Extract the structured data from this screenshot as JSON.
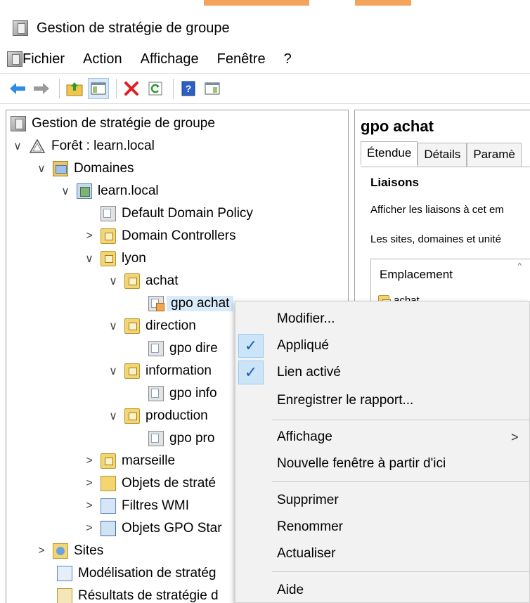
{
  "window": {
    "title": "Gestion de stratégie de groupe"
  },
  "menu": [
    "Fichier",
    "Action",
    "Affichage",
    "Fenêtre",
    "?"
  ],
  "toolbar": [
    "back-arrow-icon",
    "forward-arrow-icon",
    "up-folder-icon",
    "console-tree-icon",
    "delete-icon",
    "refresh-icon",
    "help-icon",
    "properties-icon"
  ],
  "tree": {
    "root": "Gestion de stratégie de groupe",
    "forest": "Forêt : learn.local",
    "domains": "Domaines",
    "domain": "learn.local",
    "default_policy": "Default Domain Policy",
    "domain_controllers": "Domain Controllers",
    "lyon": "lyon",
    "achat": "achat",
    "gpo_achat": "gpo achat",
    "direction": "direction",
    "gpo_direction": "gpo dire",
    "information": "information",
    "gpo_information": "gpo info",
    "production": "production",
    "gpo_production": "gpo pro",
    "marseille": "marseille",
    "gpo_objects": "Objets de straté",
    "wmi_filters": "Filtres WMI",
    "starter_gpos": "Objets GPO Star",
    "sites": "Sites",
    "modeling": "Modélisation de stratég",
    "results": "Résultats de stratégie d"
  },
  "details": {
    "title": "gpo achat",
    "tabs": [
      "Étendue",
      "Détails",
      "Paramè"
    ],
    "links_heading": "Liaisons",
    "links_desc": "Afficher les liaisons à cet em",
    "links_desc2": "Les sites, domaines et unité",
    "column": "Emplacement",
    "row": "achat"
  },
  "context_menu": {
    "modifier": "Modifier...",
    "applique": "Appliqué",
    "lien_active": "Lien activé",
    "enregistrer": "Enregistrer le rapport...",
    "affichage": "Affichage",
    "nouvelle_fenetre": "Nouvelle fenêtre à partir d'ici",
    "supprimer": "Supprimer",
    "renommer": "Renommer",
    "actualiser": "Actualiser",
    "aide": "Aide",
    "applique_checked": true,
    "lien_active_checked": true
  }
}
